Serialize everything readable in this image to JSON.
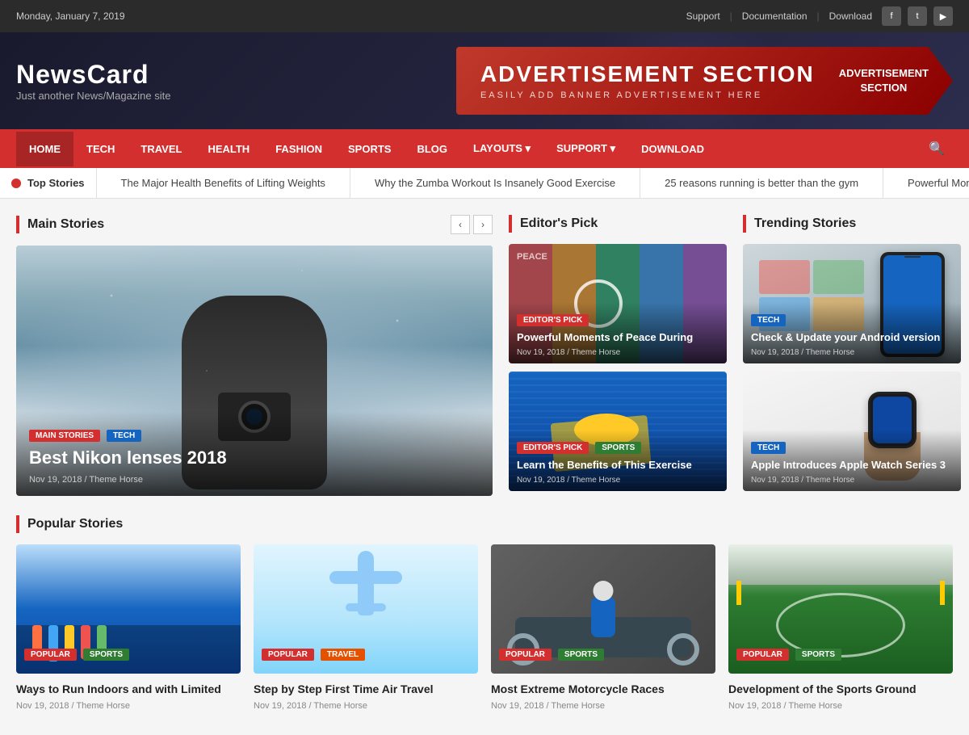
{
  "topbar": {
    "date": "Monday, January 7, 2019",
    "links": [
      "Support",
      "Documentation",
      "Download"
    ],
    "social": [
      "f",
      "t",
      "▶"
    ]
  },
  "header": {
    "logo": "NewsCard",
    "tagline": "Just another News/Magazine site",
    "ad": {
      "main": "ADVERTISEMENT SECTION",
      "sub": "EASILY ADD BANNER ADVERTISEMENT HERE",
      "side": "ADVERTISEMENT\nSECTION"
    }
  },
  "nav": {
    "items": [
      {
        "label": "HOME",
        "active": true
      },
      {
        "label": "TECH",
        "active": false
      },
      {
        "label": "TRAVEL",
        "active": false
      },
      {
        "label": "HEALTH",
        "active": false
      },
      {
        "label": "FASHION",
        "active": false
      },
      {
        "label": "SPORTS",
        "active": false
      },
      {
        "label": "BLOG",
        "active": false
      },
      {
        "label": "LAYOUTS ▾",
        "active": false
      },
      {
        "label": "SUPPORT ▾",
        "active": false
      },
      {
        "label": "DOWNLOAD",
        "active": false
      }
    ]
  },
  "ticker": {
    "label": "Top Stories",
    "items": [
      "The Major Health Benefits of Lifting Weights",
      "Why the Zumba Workout Is Insanely Good Exercise",
      "25 reasons running is better than the gym",
      "Powerful Moments of Peace Du..."
    ]
  },
  "mainStories": {
    "heading": "Main Stories",
    "hero": {
      "tags": [
        "MAIN STORIES",
        "TECH"
      ],
      "title": "Best Nikon lenses 2018",
      "meta": "Nov 19, 2018 / Theme Horse"
    }
  },
  "editorsPick": {
    "heading": "Editor's Pick",
    "cards": [
      {
        "tag": "EDITOR'S PICK",
        "title": "Powerful Moments of Peace During",
        "meta": "Nov 19, 2018 / Theme Horse"
      },
      {
        "tags": [
          "EDITOR'S PICK",
          "SPORTS"
        ],
        "title": "Learn the Benefits of This Exercise",
        "meta": "Nov 19, 2018 / Theme Horse"
      }
    ]
  },
  "trending": {
    "heading": "Trending Stories",
    "cards": [
      {
        "tag": "TECH",
        "title": "Check & Update your Android version",
        "meta": "Nov 19, 2018 / Theme Horse"
      },
      {
        "tag": "TECH",
        "title": "Apple Introduces Apple Watch Series 3",
        "meta": "Nov 19, 2018 / Theme Horse"
      }
    ]
  },
  "popular": {
    "heading": "Popular Stories",
    "cards": [
      {
        "tags": [
          "POPULAR",
          "SPORTS"
        ],
        "title": "Ways to Run Indoors and with Limited",
        "meta": "Nov 19, 2018 / Theme Horse"
      },
      {
        "tags": [
          "POPULAR",
          "TRAVEL"
        ],
        "title": "Step by Step First Time Air Travel",
        "meta": "Nov 19, 2018 / Theme Horse"
      },
      {
        "tags": [
          "POPULAR",
          "SPORTS"
        ],
        "title": "Most Extreme Motorcycle Races",
        "meta": "Nov 19, 2018 / Theme Horse"
      },
      {
        "tags": [
          "POPULAR",
          "SPORTS"
        ],
        "title": "Development of the Sports Ground",
        "meta": "Nov 19, 2018 / Theme Horse"
      }
    ]
  }
}
